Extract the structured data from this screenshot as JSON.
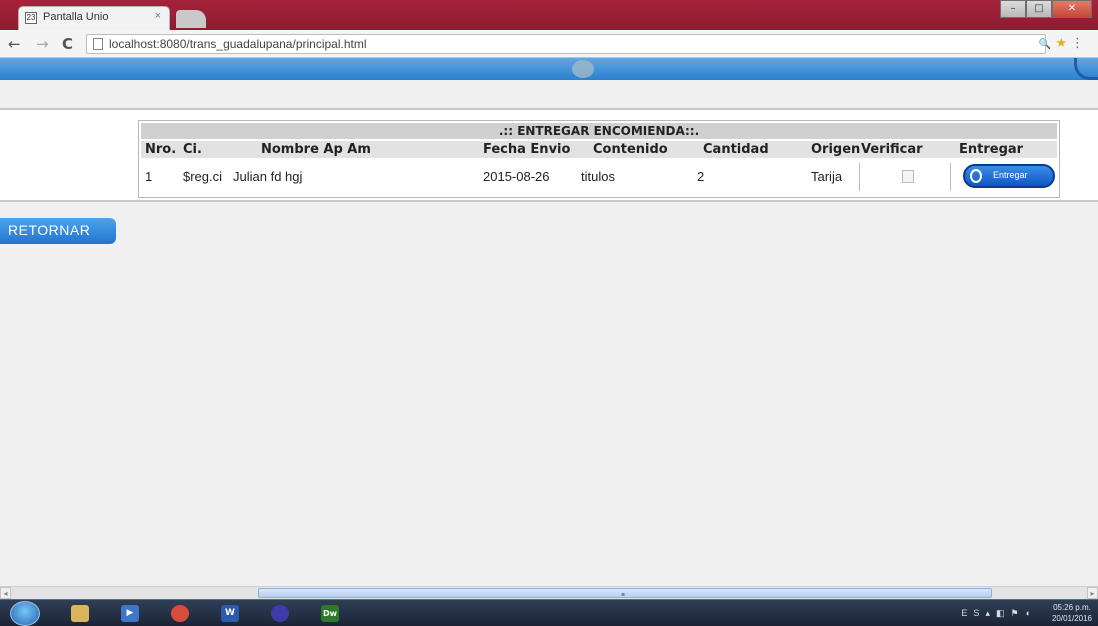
{
  "browser": {
    "tab_title": "Pantalla Unio",
    "tab_close": "×",
    "favicon_text": "23",
    "url": "localhost:8080/trans_guadalupana/principal.html",
    "back": "←",
    "forward": "→",
    "reload": "C",
    "zoom_icon": "🔍",
    "star_icon": "★",
    "menu_icon": "⋮",
    "window_minimize": "–",
    "window_maximize": "□",
    "window_close": "✕"
  },
  "table": {
    "caption": ".:: ENTREGAR ENCOMIENDA::.",
    "columns": [
      "Nro.",
      "Ci.",
      "Nombre Ap Am",
      "Fecha Envio",
      "Contenido",
      "Cantidad",
      "Origen",
      "Verificar",
      "Entregar"
    ],
    "rows": [
      {
        "nro": "1",
        "ci": "$reg.ci",
        "nombre": "Julian fd hgj",
        "fecha": "2015-08-26",
        "contenido": "titulos",
        "cantidad": "2",
        "origen": "Tarija",
        "entregar_label": "Entregar"
      }
    ]
  },
  "actions": {
    "retornar_label": "RETORNAR"
  },
  "taskbar": {
    "apps": [
      {
        "name": "explorer",
        "glyph": "",
        "color": "#d9b45a"
      },
      {
        "name": "media",
        "glyph": "▶",
        "color": "#3f76c8"
      },
      {
        "name": "chrome",
        "glyph": "",
        "color": "#d94c3b"
      },
      {
        "name": "word",
        "glyph": "W",
        "color": "#2a5cae"
      },
      {
        "name": "eclipse",
        "glyph": "",
        "color": "#3e3aa8"
      },
      {
        "name": "dreamweaver",
        "glyph": "Dw",
        "color": "#2f7a2a"
      }
    ],
    "tray_lang": "ES",
    "clock_time": "05:26 p.m.",
    "clock_date": "20/01/2016"
  },
  "colors": {
    "header_blue": "#2d7fcf",
    "button_blue": "#2274cf",
    "titlebar_red": "#8e1b30"
  }
}
